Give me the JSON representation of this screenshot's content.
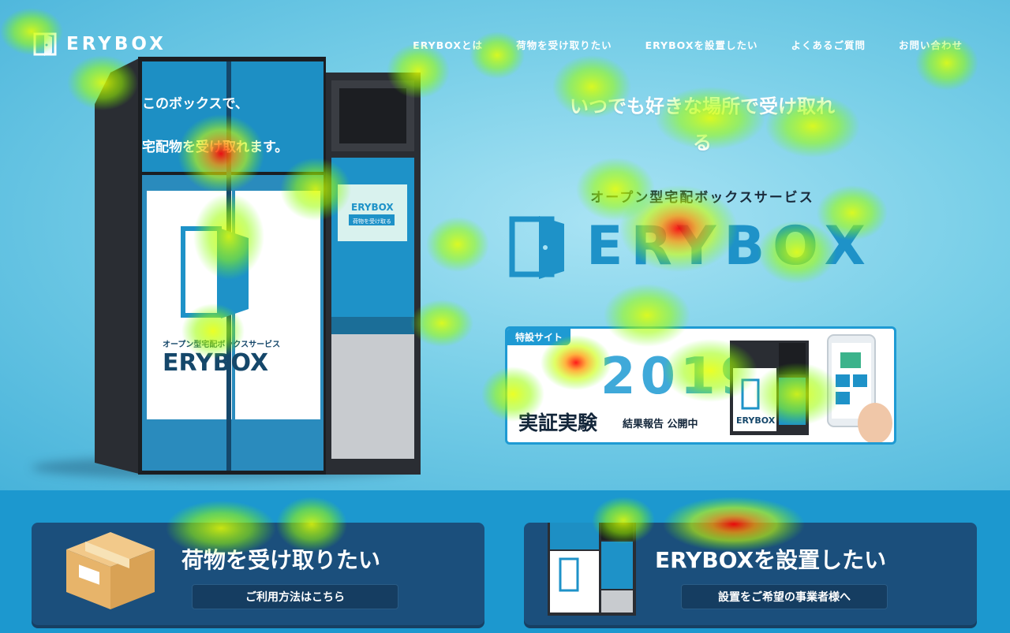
{
  "header": {
    "logo_text": "ERYBOX",
    "nav": [
      "ERYBOXとは",
      "荷物を受け取りたい",
      "ERYBOXを設置したい",
      "よくあるご質問",
      "お問い合わせ"
    ]
  },
  "machine": {
    "panel_text_1": "このボックスで、",
    "panel_text_2": "宅配物を受け取れます。",
    "door_caption": "オープン型宅配ボックスサービス",
    "door_logo": "ERYBOX",
    "screen_logo": "ERYBOX",
    "screen_button": "荷物を受け取る"
  },
  "hero": {
    "headline_1": "いつでも好きな場所で受け取れ",
    "headline_2": "る",
    "subhead": "オープン型宅配ボックスサービス",
    "big_logo": "ERYBOX"
  },
  "banner": {
    "tag": "特設サイト",
    "year": "2019",
    "title": "実証実験",
    "subtitle": "結果報告 公開中",
    "mini_logo": "ERYBOX"
  },
  "cards": [
    {
      "title": "荷物を受け取りたい",
      "button": "ご利用方法はこちら"
    },
    {
      "title": "ERYBOXを設置したい",
      "button": "設置をご希望の事業者様へ"
    }
  ],
  "colors": {
    "brand_blue": "#1e92c8",
    "card_navy": "#1b4f7c",
    "bottom_band": "#1c98cf"
  }
}
